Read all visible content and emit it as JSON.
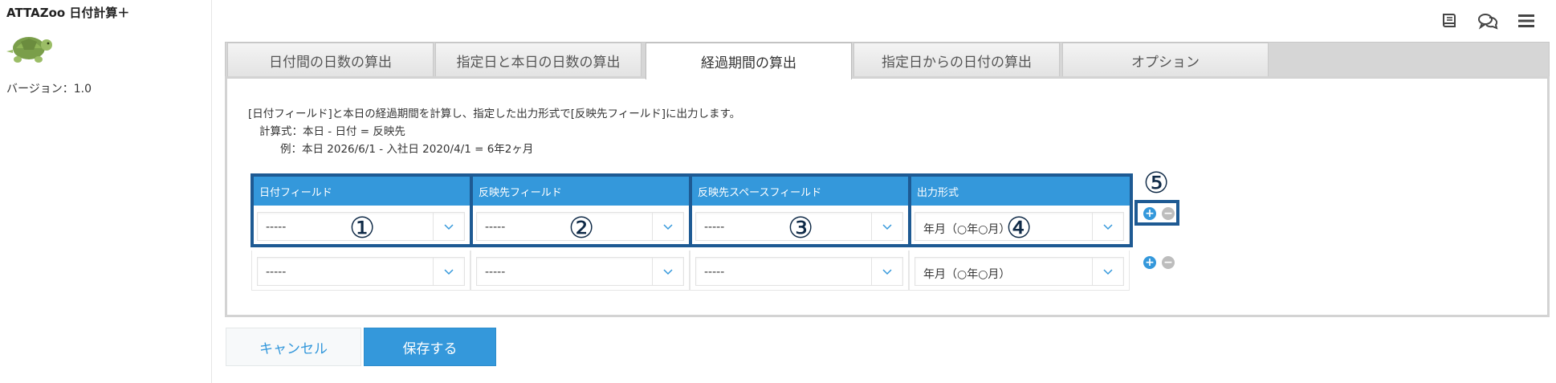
{
  "app": {
    "title": "ATTAZoo 日付計算＋",
    "version": "バージョン：1.0"
  },
  "tabs": [
    {
      "label": "日付間の日数の算出",
      "active": false
    },
    {
      "label": "指定日と本日の日数の算出",
      "active": false
    },
    {
      "label": "経過期間の算出",
      "active": true
    },
    {
      "label": "指定日からの日付の算出",
      "active": false
    },
    {
      "label": "オプション",
      "active": false
    }
  ],
  "description": {
    "line1": "[日付フィールド]と本日の経過期間を計算し、指定した出力形式で[反映先フィールド]に出力します。",
    "line2": "計算式：本日 - 日付 = 反映先",
    "line3": "例：本日 2026/6/1 - 入社日 2020/4/1 = 6年2ヶ月"
  },
  "table": {
    "headers": [
      "日付フィールド",
      "反映先フィールド",
      "反映先スペースフィールド",
      "出力形式"
    ],
    "rows": [
      [
        "-----",
        "-----",
        "-----",
        "年月（○年○月）"
      ],
      [
        "-----",
        "-----",
        "-----",
        "年月（○年○月）"
      ]
    ]
  },
  "annotations": [
    "①",
    "②",
    "③",
    "④",
    "⑤"
  ],
  "row_controls": {
    "add": "+",
    "remove": "−"
  },
  "buttons": {
    "cancel": "キャンセル",
    "save": "保存する"
  },
  "icons": [
    "book-icon",
    "comments-icon",
    "menu-icon"
  ],
  "colors": {
    "accent": "#3498db",
    "highlight": "#1e5a93"
  }
}
